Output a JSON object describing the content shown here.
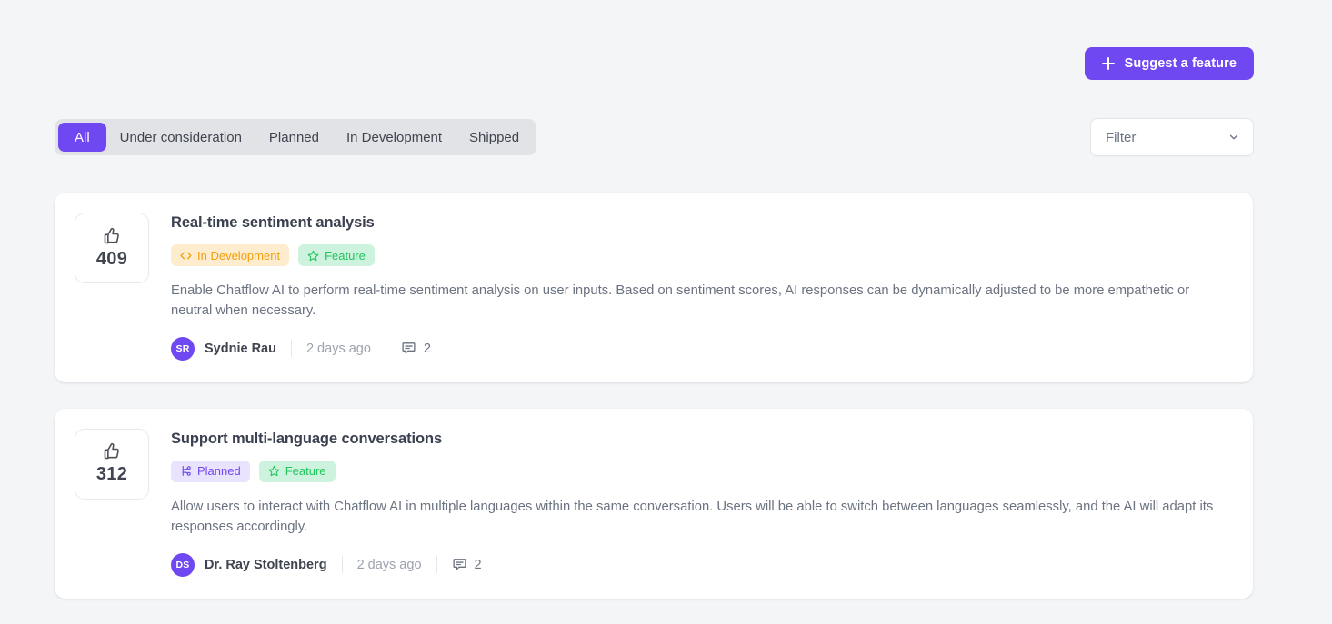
{
  "header": {
    "suggest_button": {
      "label": "Suggest a feature",
      "icon": "plus-icon",
      "color": "#7048f2"
    }
  },
  "tabs": [
    {
      "label": "All",
      "active": true
    },
    {
      "label": "Under consideration",
      "active": false
    },
    {
      "label": "Planned",
      "active": false
    },
    {
      "label": "In Development",
      "active": false
    },
    {
      "label": "Shipped",
      "active": false
    }
  ],
  "filter": {
    "label": "Filter",
    "icon": "chevron-down-icon"
  },
  "cards": [
    {
      "votes": "409",
      "vote_icon": "thumbs-up-icon",
      "title": "Real-time sentiment analysis",
      "badges": [
        {
          "label": "In Development",
          "icon": "code-icon",
          "style": "badge-dev",
          "bg": "#fdeccd",
          "fg": "#f59e0b"
        },
        {
          "label": "Feature",
          "icon": "star-icon",
          "style": "badge-feature",
          "bg": "#cdf3de",
          "fg": "#22c55e"
        }
      ],
      "description": "Enable Chatflow AI to perform real-time sentiment analysis on user inputs. Based on sentiment scores, AI responses can be dynamically adjusted to be more empathetic or neutral when necessary.",
      "author": {
        "initials": "SR",
        "name": "Sydnie Rau",
        "avatar_color": "#7048f2"
      },
      "time": "2 days ago",
      "comments": "2",
      "comments_icon": "comment-icon"
    },
    {
      "votes": "312",
      "vote_icon": "thumbs-up-icon",
      "title": "Support multi-language conversations",
      "badges": [
        {
          "label": "Planned",
          "icon": "git-branch-icon",
          "style": "badge-planned",
          "bg": "#e9e3fd",
          "fg": "#7048f2"
        },
        {
          "label": "Feature",
          "icon": "star-icon",
          "style": "badge-feature",
          "bg": "#cdf3de",
          "fg": "#22c55e"
        }
      ],
      "description": "Allow users to interact with Chatflow AI in multiple languages within the same conversation. Users will be able to switch between languages seamlessly, and the AI will adapt its responses accordingly.",
      "author": {
        "initials": "DS",
        "name": "Dr. Ray Stoltenberg",
        "avatar_color": "#7048f2"
      },
      "time": "2 days ago",
      "comments": "2",
      "comments_icon": "comment-icon"
    }
  ]
}
